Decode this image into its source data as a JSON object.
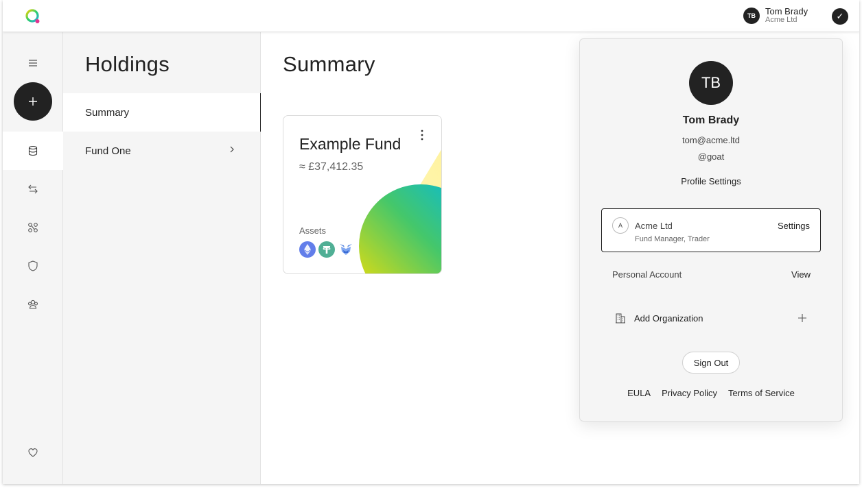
{
  "header": {
    "user_initials": "TB",
    "user_name": "Tom Brady",
    "user_org": "Acme Ltd"
  },
  "holdings": {
    "title": "Holdings",
    "items": [
      {
        "label": "Summary"
      },
      {
        "label": "Fund One"
      }
    ]
  },
  "main": {
    "title": "Summary",
    "fund_card": {
      "name": "Example Fund",
      "value": "≈ £37,412.35",
      "assets_label": "Assets",
      "assets": [
        "ethereum-icon",
        "tether-icon",
        "metamask-icon"
      ]
    }
  },
  "profile_popover": {
    "initials": "TB",
    "name": "Tom Brady",
    "email": "tom@acme.ltd",
    "handle": "@goat",
    "profile_settings": "Profile Settings",
    "organization": {
      "initial": "A",
      "name": "Acme Ltd",
      "roles": "Fund Manager, Trader",
      "settings_label": "Settings"
    },
    "personal_account": {
      "label": "Personal Account",
      "action": "View"
    },
    "add_organization": "Add Organization",
    "sign_out": "Sign Out",
    "links": [
      "EULA",
      "Privacy Policy",
      "Terms of Service"
    ]
  },
  "colors": {
    "dark": "#222222",
    "panel_bg": "#f5f5f5",
    "ethereum": "#627EEA",
    "tether": "#50AF95"
  }
}
